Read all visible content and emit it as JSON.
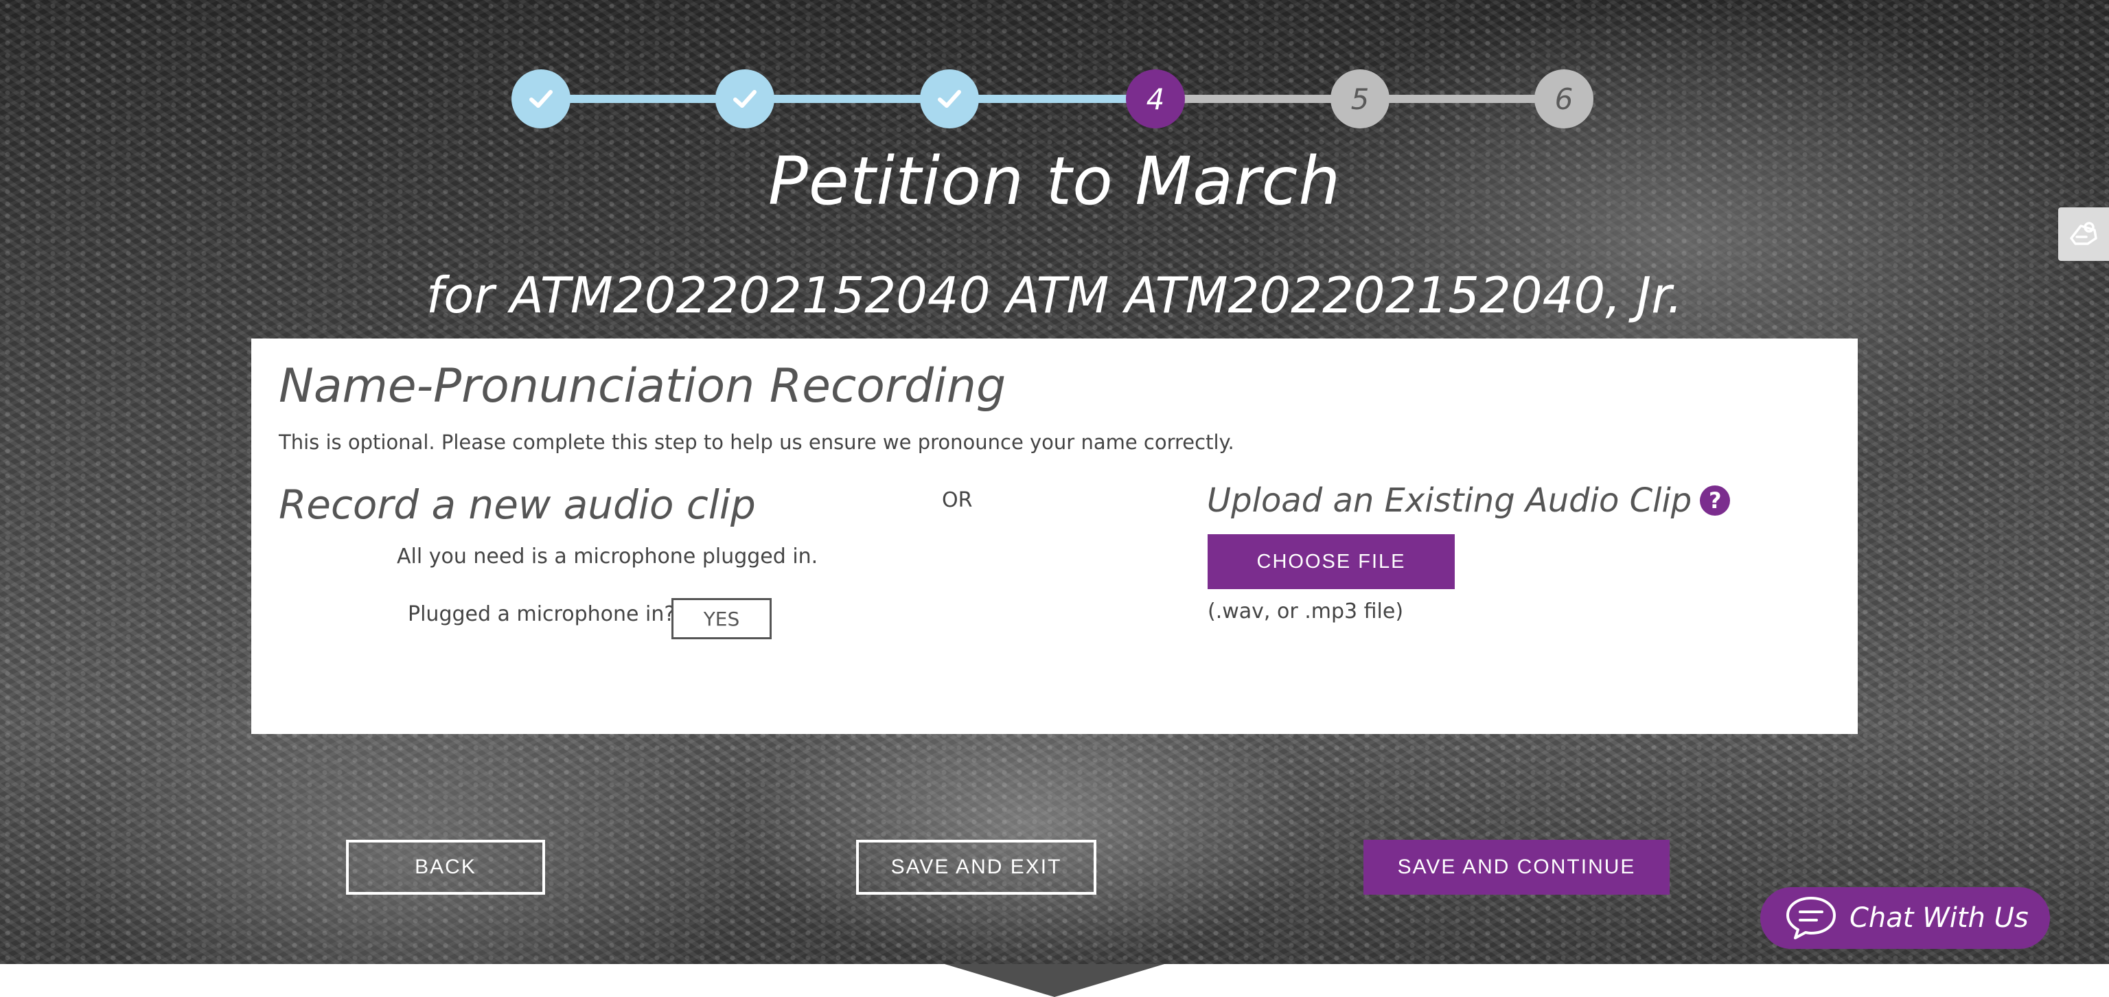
{
  "header": {
    "title": "Petition to March",
    "subtitle": "for ATM202202152040 ATM ATM202202152040, Jr."
  },
  "stepper": {
    "current_step": 4,
    "total_steps": 6,
    "steps": [
      {
        "label": "",
        "state": "done",
        "icon": "check-icon"
      },
      {
        "label": "",
        "state": "done",
        "icon": "check-icon"
      },
      {
        "label": "",
        "state": "done",
        "icon": "check-icon"
      },
      {
        "label": "4",
        "state": "current"
      },
      {
        "label": "5",
        "state": "todo"
      },
      {
        "label": "6",
        "state": "todo"
      }
    ]
  },
  "card": {
    "title": "Name-Pronunciation Recording",
    "description": "This is optional. Please complete this step to help us ensure we pronounce your name correctly.",
    "record": {
      "heading": "Record a new audio clip",
      "note": "All you need is a microphone plugged in.",
      "question": "Plugged a microphone in?",
      "yes_label": "YES"
    },
    "or_label": "OR",
    "upload": {
      "heading": "Upload an Existing Audio Clip",
      "help_glyph": "?",
      "choose_label": "CHOOSE FILE",
      "file_types": "(.wav, or .mp3 file)"
    }
  },
  "nav": {
    "back_label": "BACK",
    "save_exit_label": "SAVE AND EXIT",
    "save_continue_label": "SAVE AND CONTINUE"
  },
  "chat": {
    "label": "Chat With Us",
    "icon": "chat-bubble-icon"
  },
  "side_tab": {
    "icon": "accessibility-icon"
  },
  "colors": {
    "accent": "#7b2d8e",
    "step_done": "#a9d9ef",
    "step_todo": "#bdbdbd"
  }
}
